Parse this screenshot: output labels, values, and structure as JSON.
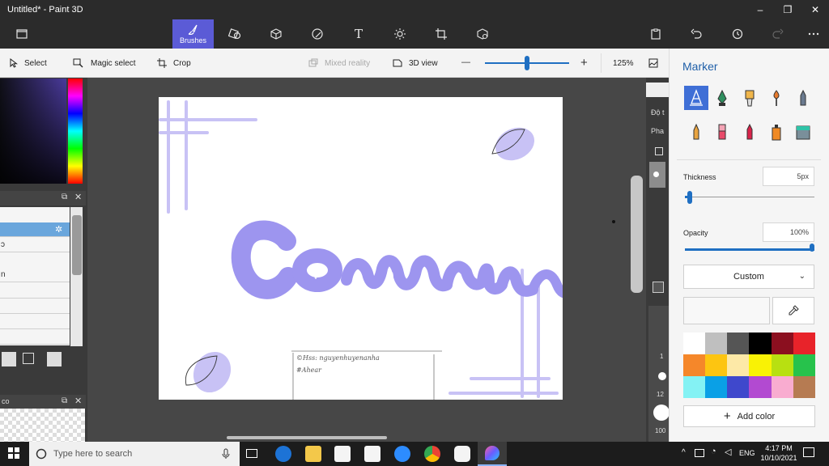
{
  "window": {
    "title": "Untitled* - Paint 3D",
    "minimize": "–",
    "maximize": "❐",
    "close": "✕"
  },
  "toolbar": {
    "active_label": "Brushes",
    "text_tool_glyph": "T"
  },
  "subbar": {
    "select": "Select",
    "magic_select": "Magic select",
    "crop": "Crop",
    "mixed_reality": "Mixed reality",
    "view_3d": "3D view",
    "zoom_minus": "—",
    "zoom_plus": "+",
    "zoom_level": "125%",
    "zoom_fraction": 0.5
  },
  "left_panel": {
    "layers": [
      "",
      "ɔ",
      "n",
      "",
      "",
      "",
      ""
    ],
    "preview_label": "co"
  },
  "right_strip": {
    "label1": "Độ t",
    "label2": "Pha",
    "num1": "1",
    "num2": "12",
    "num3": "100"
  },
  "marker_panel": {
    "title": "Marker",
    "thickness_label": "Thickness",
    "thickness_value": "5px",
    "thickness_fraction": 0.04,
    "opacity_label": "Opacity",
    "opacity_value": "100%",
    "opacity_fraction": 1.0,
    "dropdown_value": "Custom",
    "add_color": "Add color",
    "swatches": [
      "#ffffff",
      "#bfbfbf",
      "#555555",
      "#000000",
      "#8b0f1f",
      "#e8232a",
      "#f5872a",
      "#fdc511",
      "#fde9a7",
      "#f9f205",
      "#b8e011",
      "#27c24c",
      "#84f2f4",
      "#0aa0e6",
      "#3f48cc",
      "#b24ad1",
      "#f9acd0",
      "#b67b52"
    ]
  },
  "canvas": {
    "signature": "©Hss: nguyenhuyenanha",
    "hashtag": "#Ahear"
  },
  "taskbar": {
    "search_placeholder": "Type here to search",
    "lang": "ENG",
    "time": "4:17 PM",
    "date": "10/10/2021"
  },
  "colors": {
    "accent": "#5b5bd6",
    "lavender": "#b7b0f2",
    "lettering": "#9a91ec"
  }
}
